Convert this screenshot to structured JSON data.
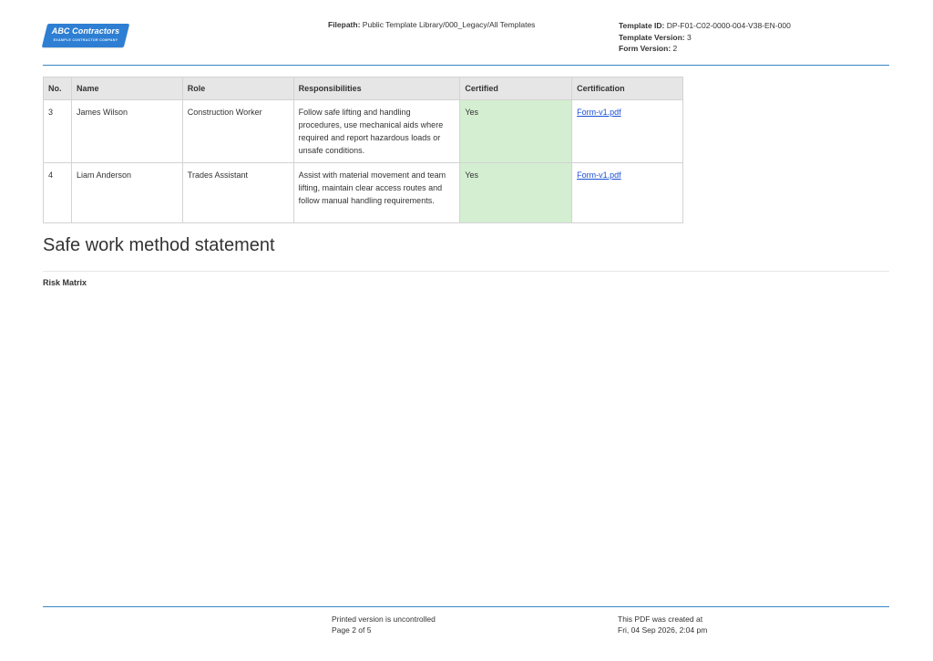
{
  "header": {
    "logo": {
      "title": "ABC Contractors",
      "subtitle": "EXAMPLE CONTRACTOR COMPANY",
      "color": "#2e7fd3"
    },
    "filepath_label": "Filepath:",
    "filepath_value": "Public Template Library/000_Legacy/All Templates",
    "template_id_label": "Template ID:",
    "template_id_value": "DP-F01-C02-0000-004-V38-EN-000",
    "template_version_label": "Template Version:",
    "template_version_value": "3",
    "form_version_label": "Form Version:",
    "form_version_value": "2"
  },
  "table": {
    "headers": [
      "No.",
      "Name",
      "Role",
      "Responsibilities",
      "Certified",
      "Certification"
    ],
    "rows": [
      {
        "no": "3",
        "name": "James Wilson",
        "role": "Construction Worker",
        "responsibilities": "Follow safe lifting and handling procedures, use mechanical aids where required and report hazardous loads or unsafe conditions.",
        "certified": "Yes",
        "certification": "Form-v1.pdf"
      },
      {
        "no": "4",
        "name": "Liam Anderson",
        "role": "Trades Assistant",
        "responsibilities": "Assist with material movement and team lifting, maintain clear access routes and follow manual handling requirements.",
        "certified": "Yes",
        "certification": "Form-v1.pdf"
      }
    ],
    "certified_color": "#d3eed0",
    "link_color": "#1a4fd6"
  },
  "section": {
    "title": "Safe work method statement",
    "risk_matrix_label": "Risk Matrix"
  },
  "footer": {
    "uncontrolled": "Printed version is uncontrolled",
    "page": "Page 2 of 5",
    "created_label": "This PDF was created at",
    "created_value": "Fri, 04 Sep 2026, 2:04 pm"
  },
  "accent_color": "#3a87c4"
}
